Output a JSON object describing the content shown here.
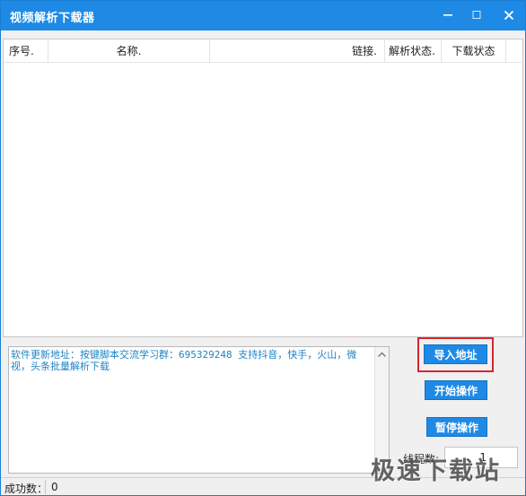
{
  "window": {
    "title": "视频解析下载器",
    "accent_color": "#1e8ae6",
    "controls": {
      "minimize_icon": "minimize-icon",
      "maximize_icon": "maximize-icon",
      "close_icon": "close-icon"
    }
  },
  "list": {
    "columns": [
      "序号.",
      "名称.",
      "链接.",
      "解析状态.",
      "下载状态",
      ""
    ],
    "rows": []
  },
  "log": {
    "text": "软件更新地址：按键脚本交流学习群：695329248 支持抖音，快手，火山，微视，头条批量解析下载"
  },
  "actions": {
    "import_label": "导入地址",
    "start_label": "开始操作",
    "pause_label": "暂停操作"
  },
  "threads": {
    "label": "线程数:",
    "value": "1"
  },
  "status": {
    "success_label": "成功数：",
    "success_value": "0"
  },
  "watermark": {
    "text": "极速下载站"
  }
}
